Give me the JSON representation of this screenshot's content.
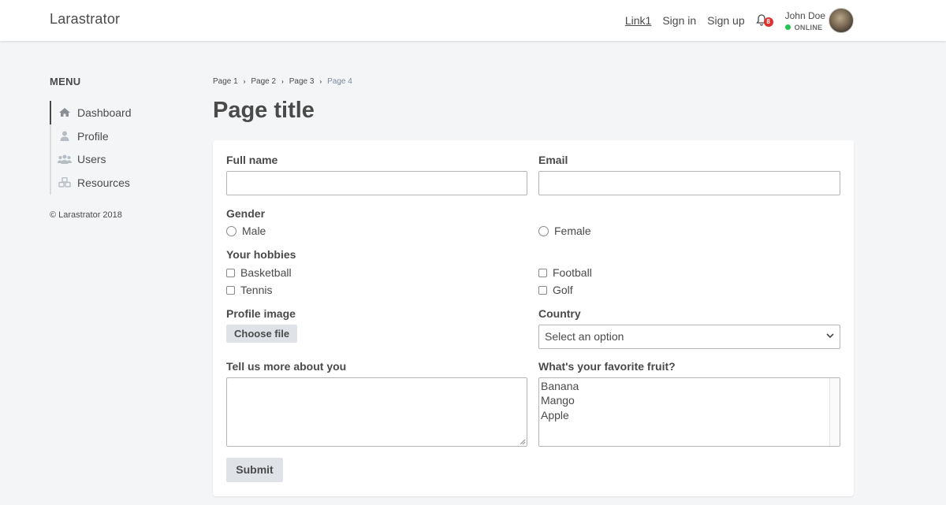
{
  "header": {
    "brand": "Larastrator",
    "links": [
      "Link1",
      "Sign in",
      "Sign up"
    ],
    "notification_count": "8",
    "user_name": "John Doe",
    "user_status": "ONLINE"
  },
  "sidebar": {
    "title": "MENU",
    "items": [
      {
        "label": "Dashboard",
        "icon": "home-icon"
      },
      {
        "label": "Profile",
        "icon": "user-icon"
      },
      {
        "label": "Users",
        "icon": "users-icon"
      },
      {
        "label": "Resources",
        "icon": "cubes-icon"
      }
    ],
    "copyright": "© Larastrator 2018"
  },
  "breadcrumb": [
    "Page 1",
    "Page 2",
    "Page 3",
    "Page 4"
  ],
  "page_title": "Page title",
  "form": {
    "full_name_label": "Full name",
    "email_label": "Email",
    "gender_label": "Gender",
    "gender_options": [
      "Male",
      "Female"
    ],
    "hobbies_label": "Your hobbies",
    "hobbies": [
      "Basketball",
      "Football",
      "Tennis",
      "Golf"
    ],
    "profile_image_label": "Profile image",
    "choose_file": "Choose file",
    "country_label": "Country",
    "country_value": "Select an option",
    "about_label": "Tell us more about you",
    "fruit_label": "What's your favorite fruit?",
    "fruits": [
      "Banana",
      "Mango",
      "Apple"
    ],
    "submit": "Submit"
  },
  "colors": {
    "background": "#f4f5f7",
    "text": "#4a4a4a",
    "online": "#23c552",
    "badge": "#e03131",
    "button": "#dfe3e8"
  }
}
